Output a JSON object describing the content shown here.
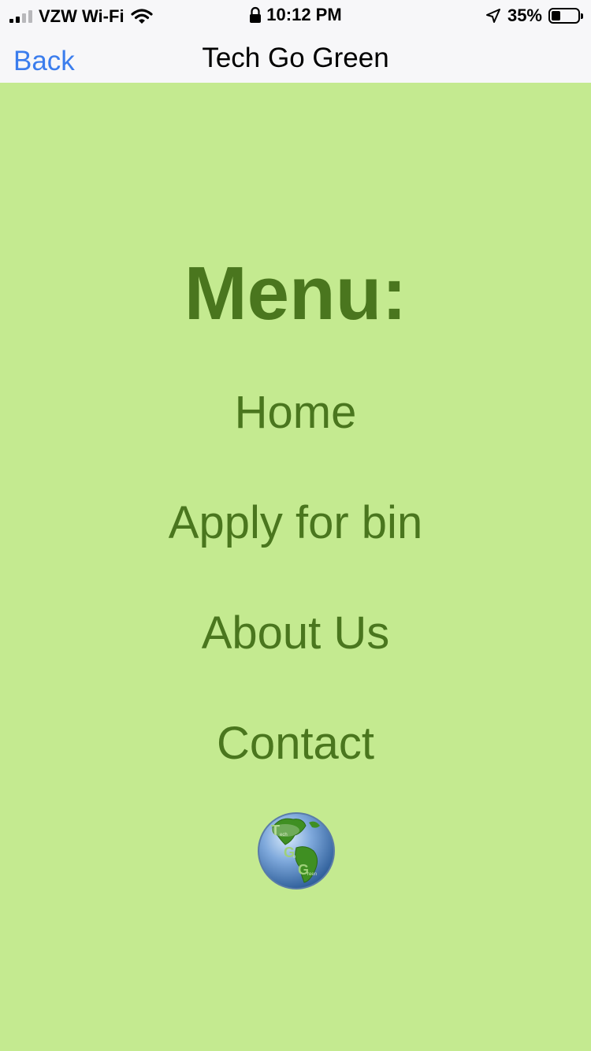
{
  "status_bar": {
    "carrier": "VZW Wi-Fi",
    "time": "10:12 PM",
    "battery_percent": "35%",
    "battery_level": 0.35,
    "icons": [
      "signal-icon",
      "wifi-icon",
      "lock-icon",
      "location-icon",
      "battery-icon"
    ]
  },
  "nav": {
    "back_label": "Back",
    "title": "Tech Go Green"
  },
  "menu": {
    "heading": "Menu:",
    "items": [
      {
        "label": "Home"
      },
      {
        "label": "Apply for bin"
      },
      {
        "label": "About Us"
      },
      {
        "label": "Contact"
      }
    ]
  },
  "logo": {
    "icon": "globe-logo-icon",
    "letters": [
      "T",
      "G",
      "G"
    ],
    "words": [
      "ech",
      "o",
      "reen"
    ]
  },
  "colors": {
    "background": "#c4ea90",
    "text_green": "#4a761e",
    "link_blue": "#3b7ded",
    "bar_background": "#f7f7f9"
  }
}
